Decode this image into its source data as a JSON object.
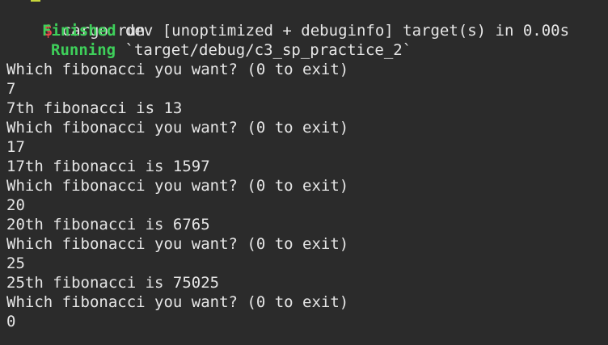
{
  "prompt": {
    "symbol": "$",
    "command": "cargo run"
  },
  "build": {
    "finished_label": "Finished",
    "finished_text": "dev [unoptimized + debuginfo] target(s) in 0.00s",
    "running_label": "Running",
    "running_text": "`target/debug/c3_sp_practice_2`"
  },
  "output_lines": [
    "Which fibonacci you want? (0 to exit)",
    "7",
    "7th fibonacci is 13",
    "Which fibonacci you want? (0 to exit)",
    "17",
    "17th fibonacci is 1597",
    "Which fibonacci you want? (0 to exit)",
    "20",
    "20th fibonacci is 6765",
    "Which fibonacci you want? (0 to exit)",
    "25",
    "25th fibonacci is 75025",
    "Which fibonacci you want? (0 to exit)",
    "0"
  ],
  "colors": {
    "background": "#2b2b2b",
    "foreground": "#e6e6e6",
    "prompt": "#e8494a",
    "status_green": "#3ecf5a"
  }
}
